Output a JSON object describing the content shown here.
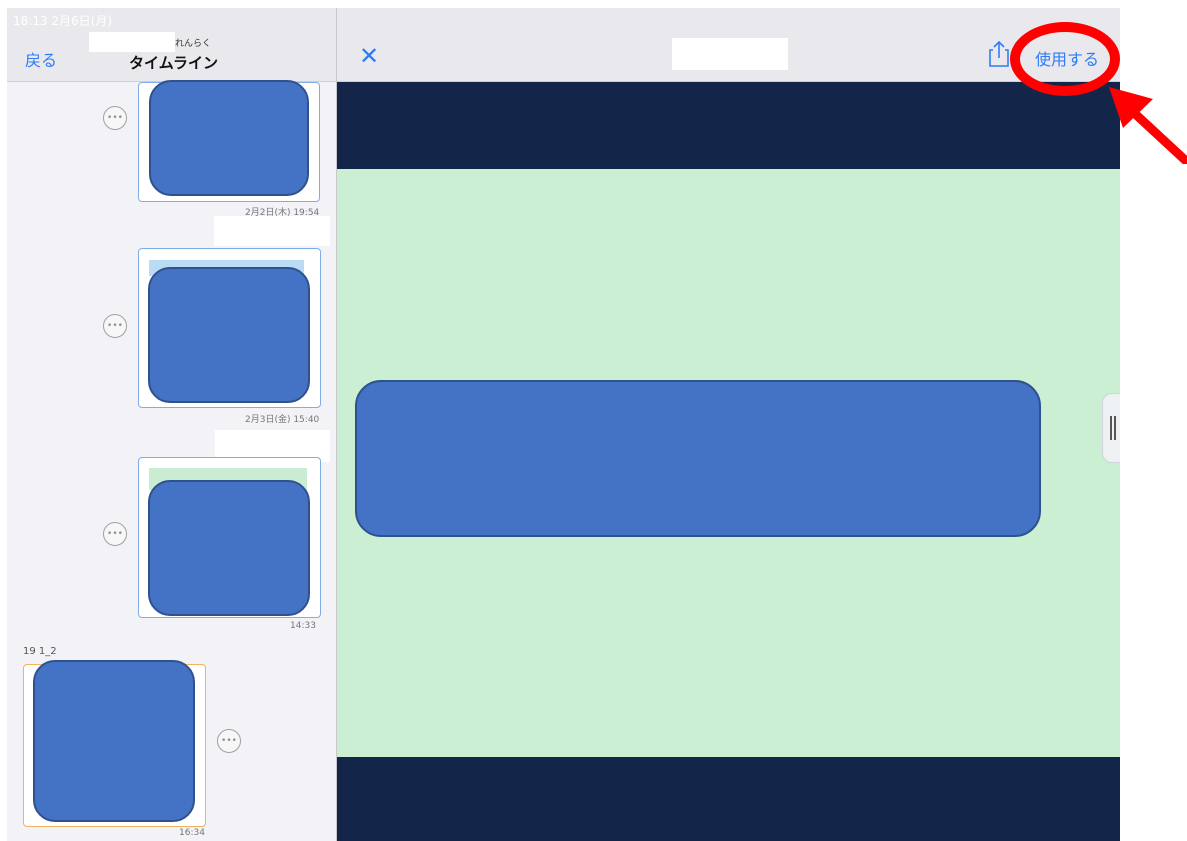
{
  "status": {
    "time": "18:13  2月6日(月)"
  },
  "left": {
    "back_label": "戻る",
    "title_ruby": "れんらく",
    "title": "タイムライン",
    "timestamps": [
      "2月2日(木) 19:54",
      "2月3日(金) 15:40",
      "14:33",
      "16:34"
    ],
    "student_label": "19 1_2",
    "more_glyph": "•••"
  },
  "right": {
    "use_label": "使用する",
    "close_glyph": "✕"
  },
  "colors": {
    "accent": "#2f7cf6",
    "band": "#14254a",
    "canvas_green": "#cbefd3",
    "blob": "#4472c4",
    "annotation": "#ff0000"
  }
}
